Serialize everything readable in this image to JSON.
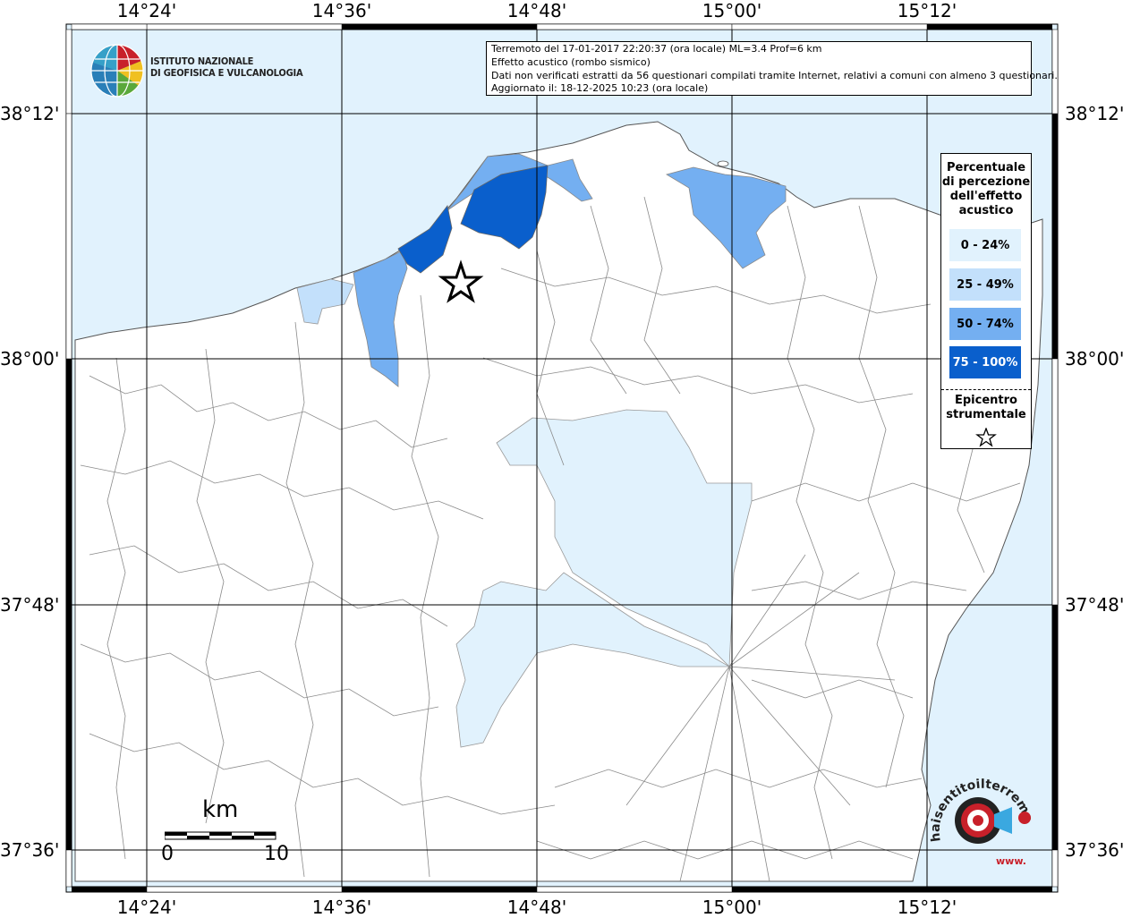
{
  "map": {
    "top_ticks": [
      "14°24'",
      "14°36'",
      "14°48'",
      "15°00'",
      "15°12'"
    ],
    "bottom_ticks": [
      "14°24'",
      "14°36'",
      "14°48'",
      "15°00'",
      "15°12'"
    ],
    "left_ticks": [
      "38°12'",
      "38°00'",
      "37°48'",
      "37°36'"
    ],
    "right_ticks": [
      "38°12'",
      "38°00'",
      "37°48'",
      "37°36'"
    ],
    "colors": {
      "sea": "#e1f2fd",
      "land": "#ffffff",
      "boundary": "#8a8a8a",
      "grid": "#000000",
      "class_0_24": "#e1f2fd",
      "class_25_49": "#c3e0fb",
      "class_50_74": "#74aff1",
      "class_75_100": "#0a5fcc"
    }
  },
  "info": {
    "line1": "Terremoto del 17-01-2017 22:20:37 (ora locale) ML=3.4 Prof=6 km",
    "line2": "Effetto acustico (rombo sismico)",
    "line3": "Dati non verificati estratti da 56 questionari compilati tramite Internet, relativi a comuni con almeno 3 questionari.",
    "line4": "Aggiornato il: 18-12-2025 10:23 (ora locale)"
  },
  "logo": {
    "line1": "ISTITUTO NAZIONALE",
    "line2": "DI GEOFISICA E VULCANOLOGIA"
  },
  "legend": {
    "title": [
      "Percentuale",
      "di percezione",
      "dell'effetto",
      "acustico"
    ],
    "classes": [
      "0 - 24%",
      "25 - 49%",
      "50 - 74%",
      "75 - 100%"
    ],
    "epicenter_label": [
      "Epicentro",
      "strumentale"
    ],
    "epicenter_icon": "star-outline-icon"
  },
  "scalebar": {
    "unit": "km",
    "min": "0",
    "max": "10"
  },
  "brand": {
    "text": "haisentitoilterremoto.it",
    "url_text": "www.",
    "icon": "target-speaker-icon"
  }
}
